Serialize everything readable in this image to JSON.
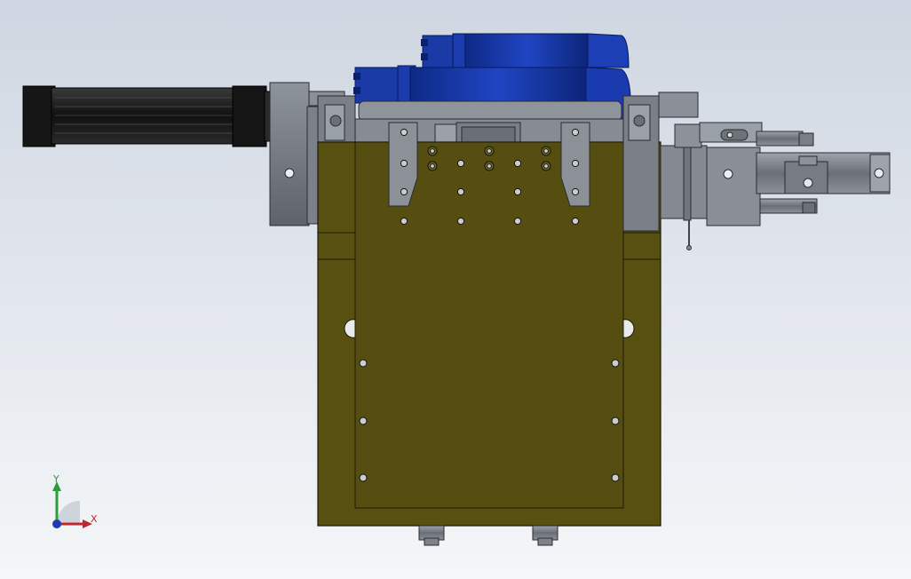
{
  "viewport": {
    "background_top": "#cfd6e1",
    "background_bottom": "#f4f6f8"
  },
  "colors": {
    "plate_olive": "#575010",
    "plate_olive_dark": "#4a4410",
    "motor_blue": "#1c3fb0",
    "motor_blue_dark": "#0d2a8a",
    "steel_gray": "#6f747c",
    "steel_light": "#9aa0a8",
    "black_motor": "#1c1c1c"
  },
  "triad": {
    "x_label": "X",
    "y_label": "Y",
    "x_color": "#c1272d",
    "y_color": "#2e9b3a",
    "z_color": "#1f3bb3"
  }
}
